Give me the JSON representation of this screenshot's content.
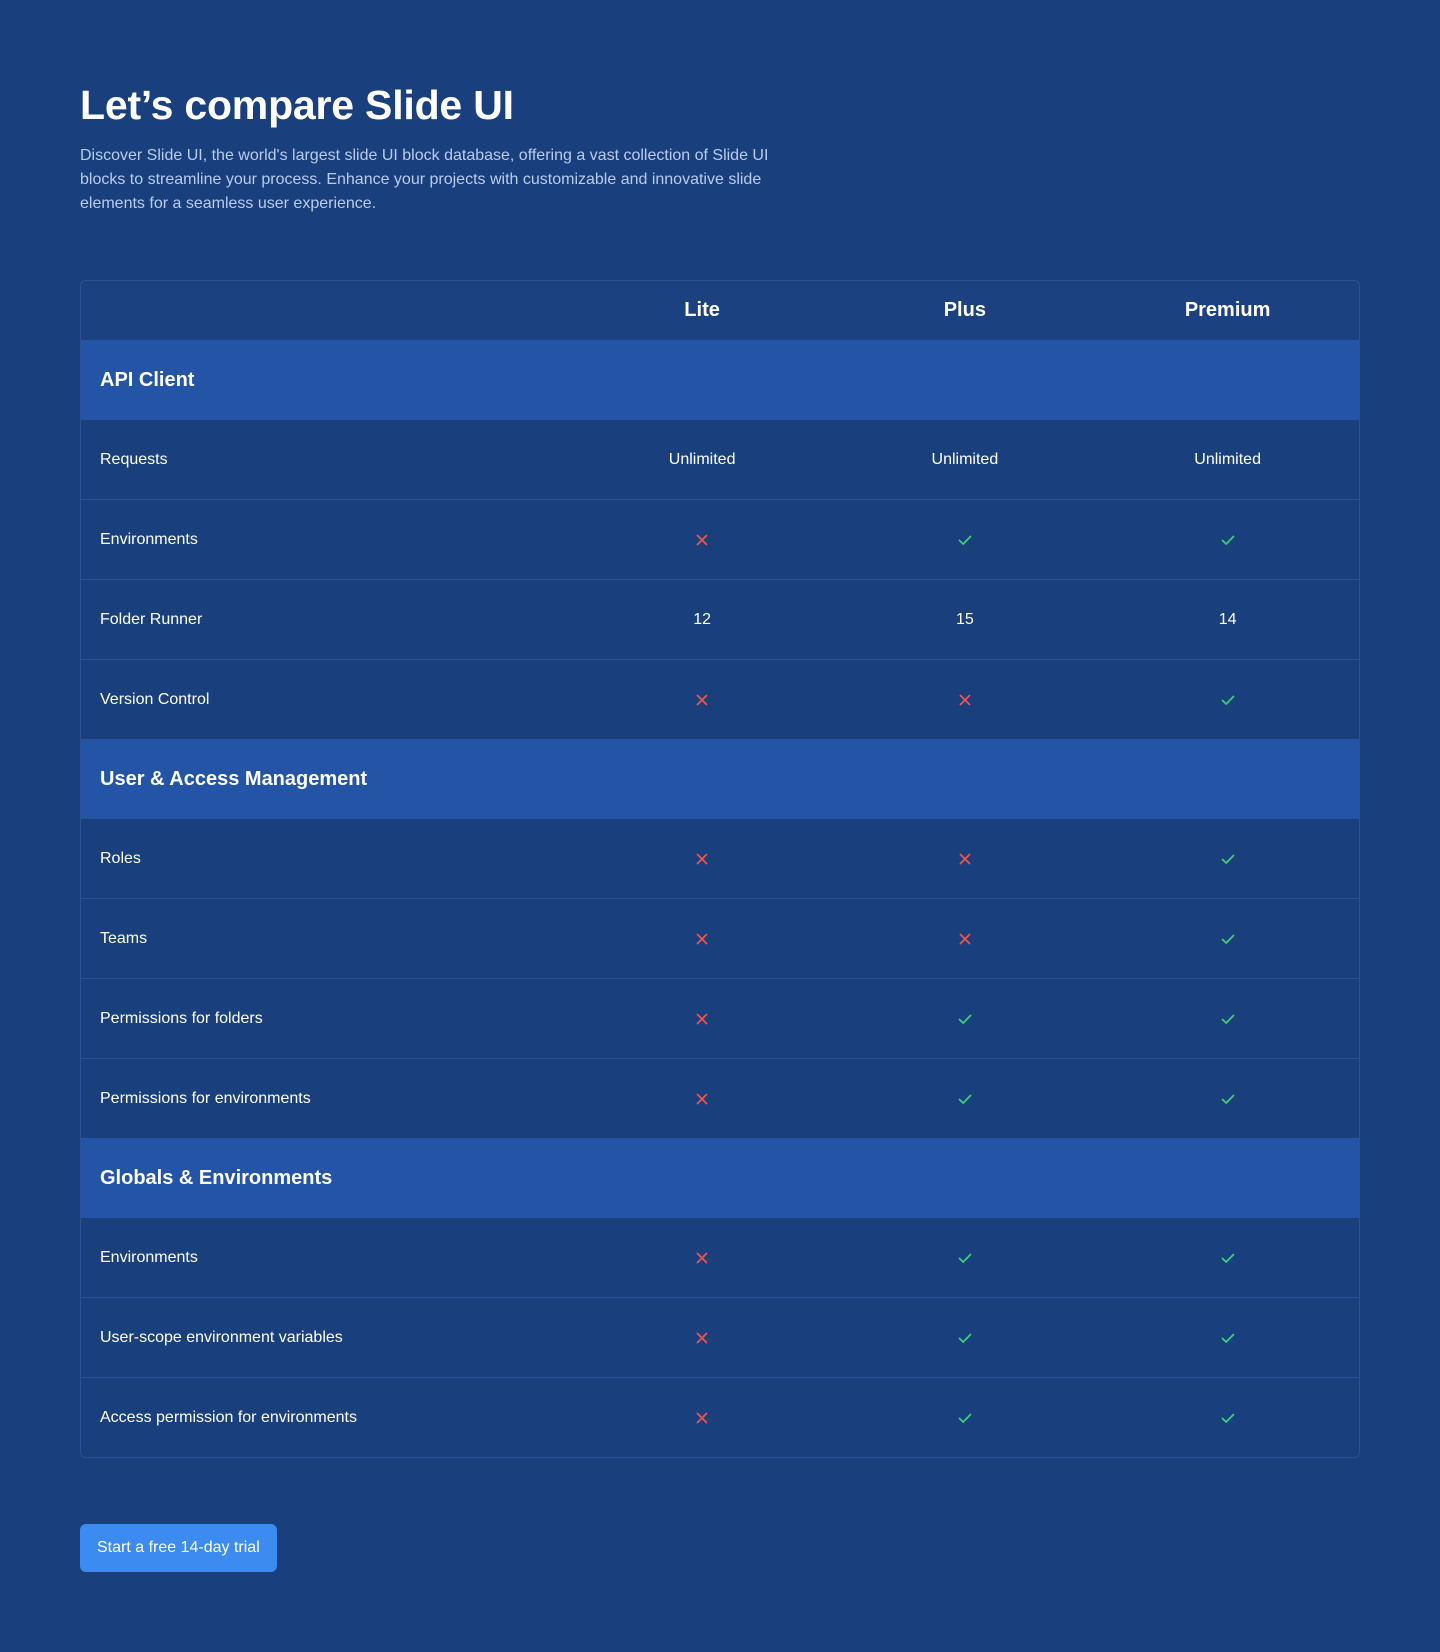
{
  "header": {
    "title": "Let’s compare Slide UI",
    "description": "Discover Slide UI, the world's largest slide UI block database, offering a vast collection of Slide UI blocks to streamline your process. Enhance your projects with customizable and innovative slide elements for a seamless user experience."
  },
  "table": {
    "plans": [
      "Lite",
      "Plus",
      "Premium"
    ],
    "sections": [
      {
        "title": "API Client",
        "rows": [
          {
            "feature": "Requests",
            "values": [
              "Unlimited",
              "Unlimited",
              "Unlimited"
            ]
          },
          {
            "feature": "Environments",
            "values": [
              "no",
              "yes",
              "yes"
            ]
          },
          {
            "feature": "Folder Runner",
            "values": [
              "12",
              "15",
              "14"
            ]
          },
          {
            "feature": "Version Control",
            "values": [
              "no",
              "no",
              "yes"
            ]
          }
        ]
      },
      {
        "title": "User & Access Management",
        "rows": [
          {
            "feature": "Roles",
            "values": [
              "no",
              "no",
              "yes"
            ]
          },
          {
            "feature": "Teams",
            "values": [
              "no",
              "no",
              "yes"
            ]
          },
          {
            "feature": "Permissions for folders",
            "values": [
              "no",
              "yes",
              "yes"
            ]
          },
          {
            "feature": "Permissions for environments",
            "values": [
              "no",
              "yes",
              "yes"
            ]
          }
        ]
      },
      {
        "title": "Globals & Environments",
        "rows": [
          {
            "feature": "Environments",
            "values": [
              "no",
              "yes",
              "yes"
            ]
          },
          {
            "feature": "User-scope environment variables",
            "values": [
              "no",
              "yes",
              "yes"
            ]
          },
          {
            "feature": "Access permission for environments",
            "values": [
              "no",
              "yes",
              "yes"
            ]
          }
        ]
      }
    ]
  },
  "icons": {
    "yes": "check-icon",
    "no": "x-icon"
  },
  "colors": {
    "background": "#1a3f7d",
    "section_band": "#2454a5",
    "check": "#3ccf7a",
    "cross": "#f0524f",
    "button": "#3b8bf0"
  },
  "cta": {
    "label": "Start a free 14-day trial"
  }
}
